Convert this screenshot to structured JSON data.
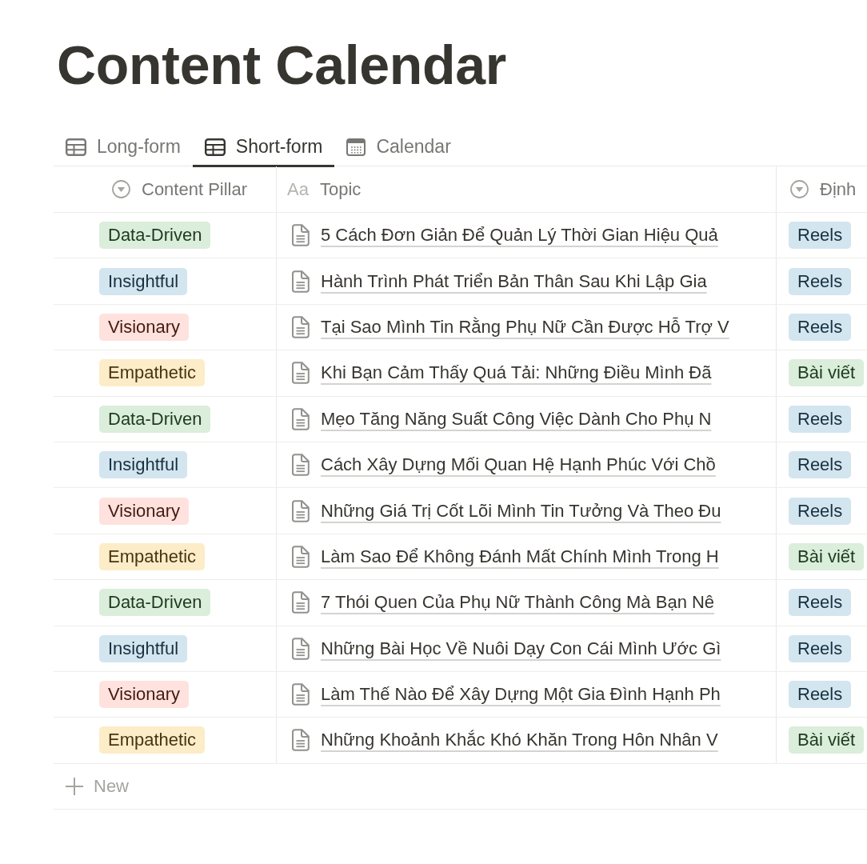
{
  "page": {
    "title": "Content Calendar"
  },
  "tabs": [
    {
      "label": "Long-form",
      "kind": "table",
      "selected": false
    },
    {
      "label": "Short-form",
      "kind": "table",
      "selected": true
    },
    {
      "label": "Calendar",
      "kind": "calendar",
      "selected": false
    }
  ],
  "table": {
    "columns": [
      {
        "label": "Content Pillar",
        "kind": "select"
      },
      {
        "label": "Topic",
        "kind": "text",
        "glyph": "Aa"
      },
      {
        "label": "Định",
        "kind": "select"
      }
    ],
    "rows": [
      {
        "pillar": {
          "label": "Data-Driven",
          "color": "#dbeddb"
        },
        "topic": "5 Cách Đơn Giản Để Quản Lý Thời Gian Hiệu Quả",
        "format": {
          "label": "Reels",
          "color": "#d3e5ef"
        }
      },
      {
        "pillar": {
          "label": "Insightful",
          "color": "#d3e5ef"
        },
        "topic": "Hành Trình Phát Triển Bản Thân Sau Khi Lập Gia",
        "format": {
          "label": "Reels",
          "color": "#d3e5ef"
        }
      },
      {
        "pillar": {
          "label": "Visionary",
          "color": "#ffe2dd"
        },
        "topic": "Tại Sao Mình Tin Rằng Phụ Nữ Cần Được Hỗ Trợ V",
        "format": {
          "label": "Reels",
          "color": "#d3e5ef"
        }
      },
      {
        "pillar": {
          "label": "Empathetic",
          "color": "#fdecc8"
        },
        "topic": "Khi Bạn Cảm Thấy Quá Tải: Những Điều Mình Đã",
        "format": {
          "label": "Bài viết",
          "color": "#dbeddb"
        }
      },
      {
        "pillar": {
          "label": "Data-Driven",
          "color": "#dbeddb"
        },
        "topic": "Mẹo Tăng Năng Suất Công Việc Dành Cho Phụ N",
        "format": {
          "label": "Reels",
          "color": "#d3e5ef"
        }
      },
      {
        "pillar": {
          "label": "Insightful",
          "color": "#d3e5ef"
        },
        "topic": "Cách Xây Dựng Mối Quan Hệ Hạnh Phúc Với Chồ",
        "format": {
          "label": "Reels",
          "color": "#d3e5ef"
        }
      },
      {
        "pillar": {
          "label": "Visionary",
          "color": "#ffe2dd"
        },
        "topic": "Những Giá Trị Cốt Lõi Mình Tin Tưởng Và Theo Đu",
        "format": {
          "label": "Reels",
          "color": "#d3e5ef"
        }
      },
      {
        "pillar": {
          "label": "Empathetic",
          "color": "#fdecc8"
        },
        "topic": "Làm Sao Để Không Đánh Mất Chính Mình Trong H",
        "format": {
          "label": "Bài viết",
          "color": "#dbeddb"
        }
      },
      {
        "pillar": {
          "label": "Data-Driven",
          "color": "#dbeddb"
        },
        "topic": "7 Thói Quen Của Phụ Nữ Thành Công Mà Bạn Nê",
        "format": {
          "label": "Reels",
          "color": "#d3e5ef"
        }
      },
      {
        "pillar": {
          "label": "Insightful",
          "color": "#d3e5ef"
        },
        "topic": "Những Bài Học Về Nuôi Dạy Con Cái Mình Ước Gì",
        "format": {
          "label": "Reels",
          "color": "#d3e5ef"
        }
      },
      {
        "pillar": {
          "label": "Visionary",
          "color": "#ffe2dd"
        },
        "topic": "Làm Thế Nào Để Xây Dựng Một Gia Đình Hạnh Ph",
        "format": {
          "label": "Reels",
          "color": "#d3e5ef"
        }
      },
      {
        "pillar": {
          "label": "Empathetic",
          "color": "#fdecc8"
        },
        "topic": "Những Khoảnh Khắc Khó Khăn Trong Hôn Nhân V",
        "format": {
          "label": "Bài viết",
          "color": "#dbeddb"
        }
      }
    ]
  },
  "new_row": {
    "label": "New"
  }
}
